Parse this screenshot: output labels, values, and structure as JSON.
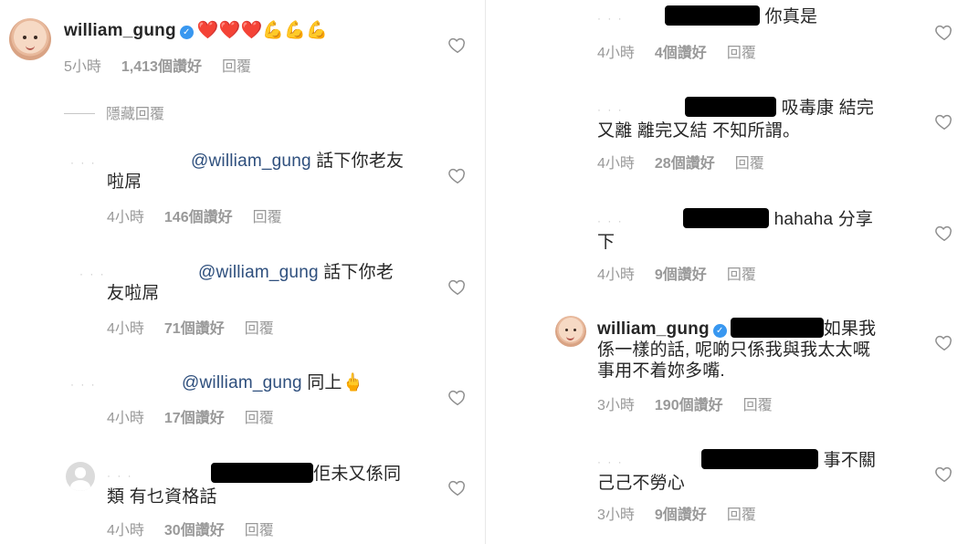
{
  "colors": {
    "accent_mention": "#2e4f7d",
    "meta": "#999999",
    "verified": "#3897f0"
  },
  "left": {
    "top_comment": {
      "username": "william_gung",
      "text": "❤️❤️❤️💪💪💪",
      "time": "5小時",
      "likes": "1,413個讚好",
      "reply": "回覆"
    },
    "hide_replies": "隱藏回覆",
    "replies": [
      {
        "mention": "@william_gung",
        "text": " 話下你老友",
        "text2": "啦屌",
        "time": "4小時",
        "likes": "146個讚好",
        "reply": "回覆"
      },
      {
        "mention": "@william_gung",
        "text": " 話下你老",
        "text2": "友啦屌",
        "time": "4小時",
        "likes": "71個讚好",
        "reply": "回覆"
      },
      {
        "mention": "@william_gung",
        "text": " 同上🖕",
        "time": "4小時",
        "likes": "17個讚好",
        "reply": "回覆"
      },
      {
        "text": "佢未又係同",
        "text2": "類 有乜資格話",
        "time": "4小時",
        "likes": "30個讚好",
        "reply": "回覆"
      }
    ]
  },
  "right": {
    "comments": [
      {
        "text": "你真是",
        "time": "4小時",
        "likes": "4個讚好",
        "reply": "回覆"
      },
      {
        "text": "吸毒康 結完",
        "text2": "又離 離完又結 不知所謂。",
        "time": "4小時",
        "likes": "28個讚好",
        "reply": "回覆"
      },
      {
        "text": "hahaha 分享",
        "text2": "下",
        "time": "4小時",
        "likes": "9個讚好",
        "reply": "回覆"
      },
      {
        "username": "william_gung",
        "text": "如果我",
        "text2": "係一樣的話, 呢啲只係我與我太太嘅",
        "text3": "事用不着妳多嘴.",
        "time": "3小時",
        "likes": "190個讚好",
        "reply": "回覆"
      },
      {
        "text": "事不關",
        "text2": "己己不勞心",
        "time": "3小時",
        "likes": "9個讚好",
        "reply": "回覆"
      }
    ]
  },
  "icons": {
    "like": "heart-outline-icon",
    "verified": "verified-badge-icon"
  }
}
